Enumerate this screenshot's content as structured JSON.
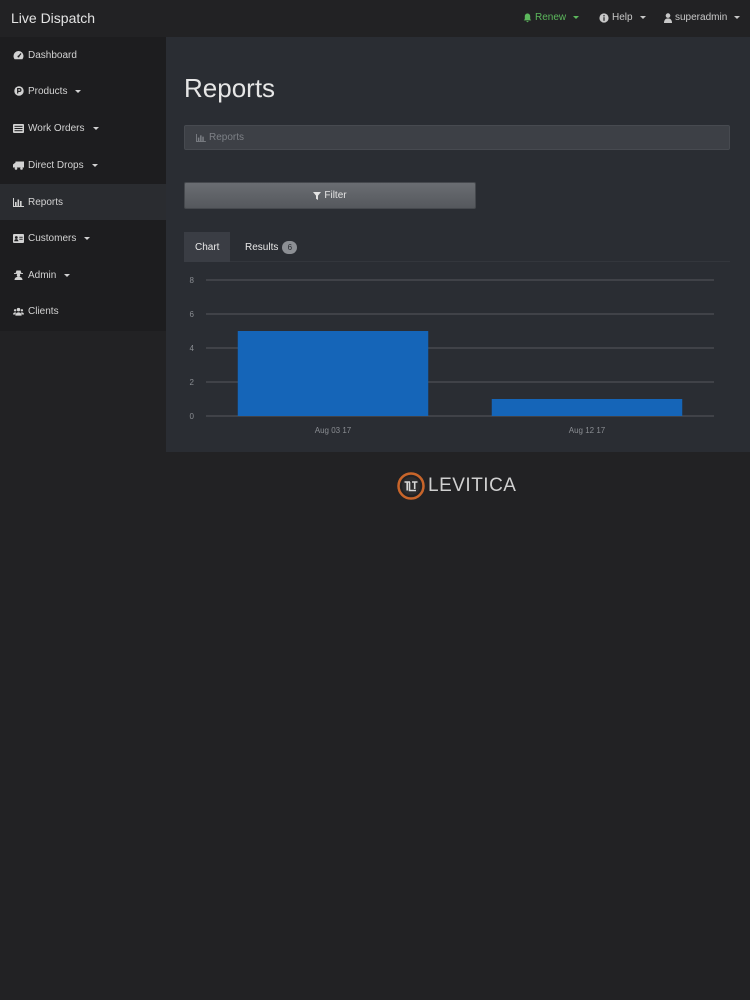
{
  "navbar": {
    "brand": "Live Dispatch",
    "renew": "Renew",
    "help": "Help",
    "user": "superadmin"
  },
  "sidebar": {
    "items": [
      {
        "label": "Dashboard",
        "icon": "dashboard-icon"
      },
      {
        "label": "Products",
        "icon": "products-icon",
        "dropdown": true
      },
      {
        "label": "Work Orders",
        "icon": "work-orders-icon",
        "dropdown": true
      },
      {
        "label": "Direct Drops",
        "icon": "truck-icon",
        "dropdown": true
      },
      {
        "label": "Reports",
        "icon": "bar-chart-icon",
        "active": true
      },
      {
        "label": "Customers",
        "icon": "address-card-icon",
        "dropdown": true
      },
      {
        "label": "Admin",
        "icon": "user-secret-icon",
        "dropdown": true
      },
      {
        "label": "Clients",
        "icon": "users-icon"
      }
    ]
  },
  "main": {
    "title": "Reports",
    "breadcrumb": "Reports",
    "filter_label": "Filter",
    "tabs": {
      "chart": "Chart",
      "results": "Results",
      "results_count": "6"
    }
  },
  "colors": {
    "bar": "#1565b8",
    "renew": "#5cb85c"
  },
  "chart_data": {
    "type": "bar",
    "categories": [
      "Aug 03 17",
      "Aug 12 17"
    ],
    "values": [
      5,
      1
    ],
    "y_ticks": [
      "0",
      "2",
      "4",
      "6",
      "8"
    ],
    "ylim": [
      0,
      8
    ],
    "grid": true
  },
  "footer": {
    "logo_text": "LEVITICA"
  }
}
